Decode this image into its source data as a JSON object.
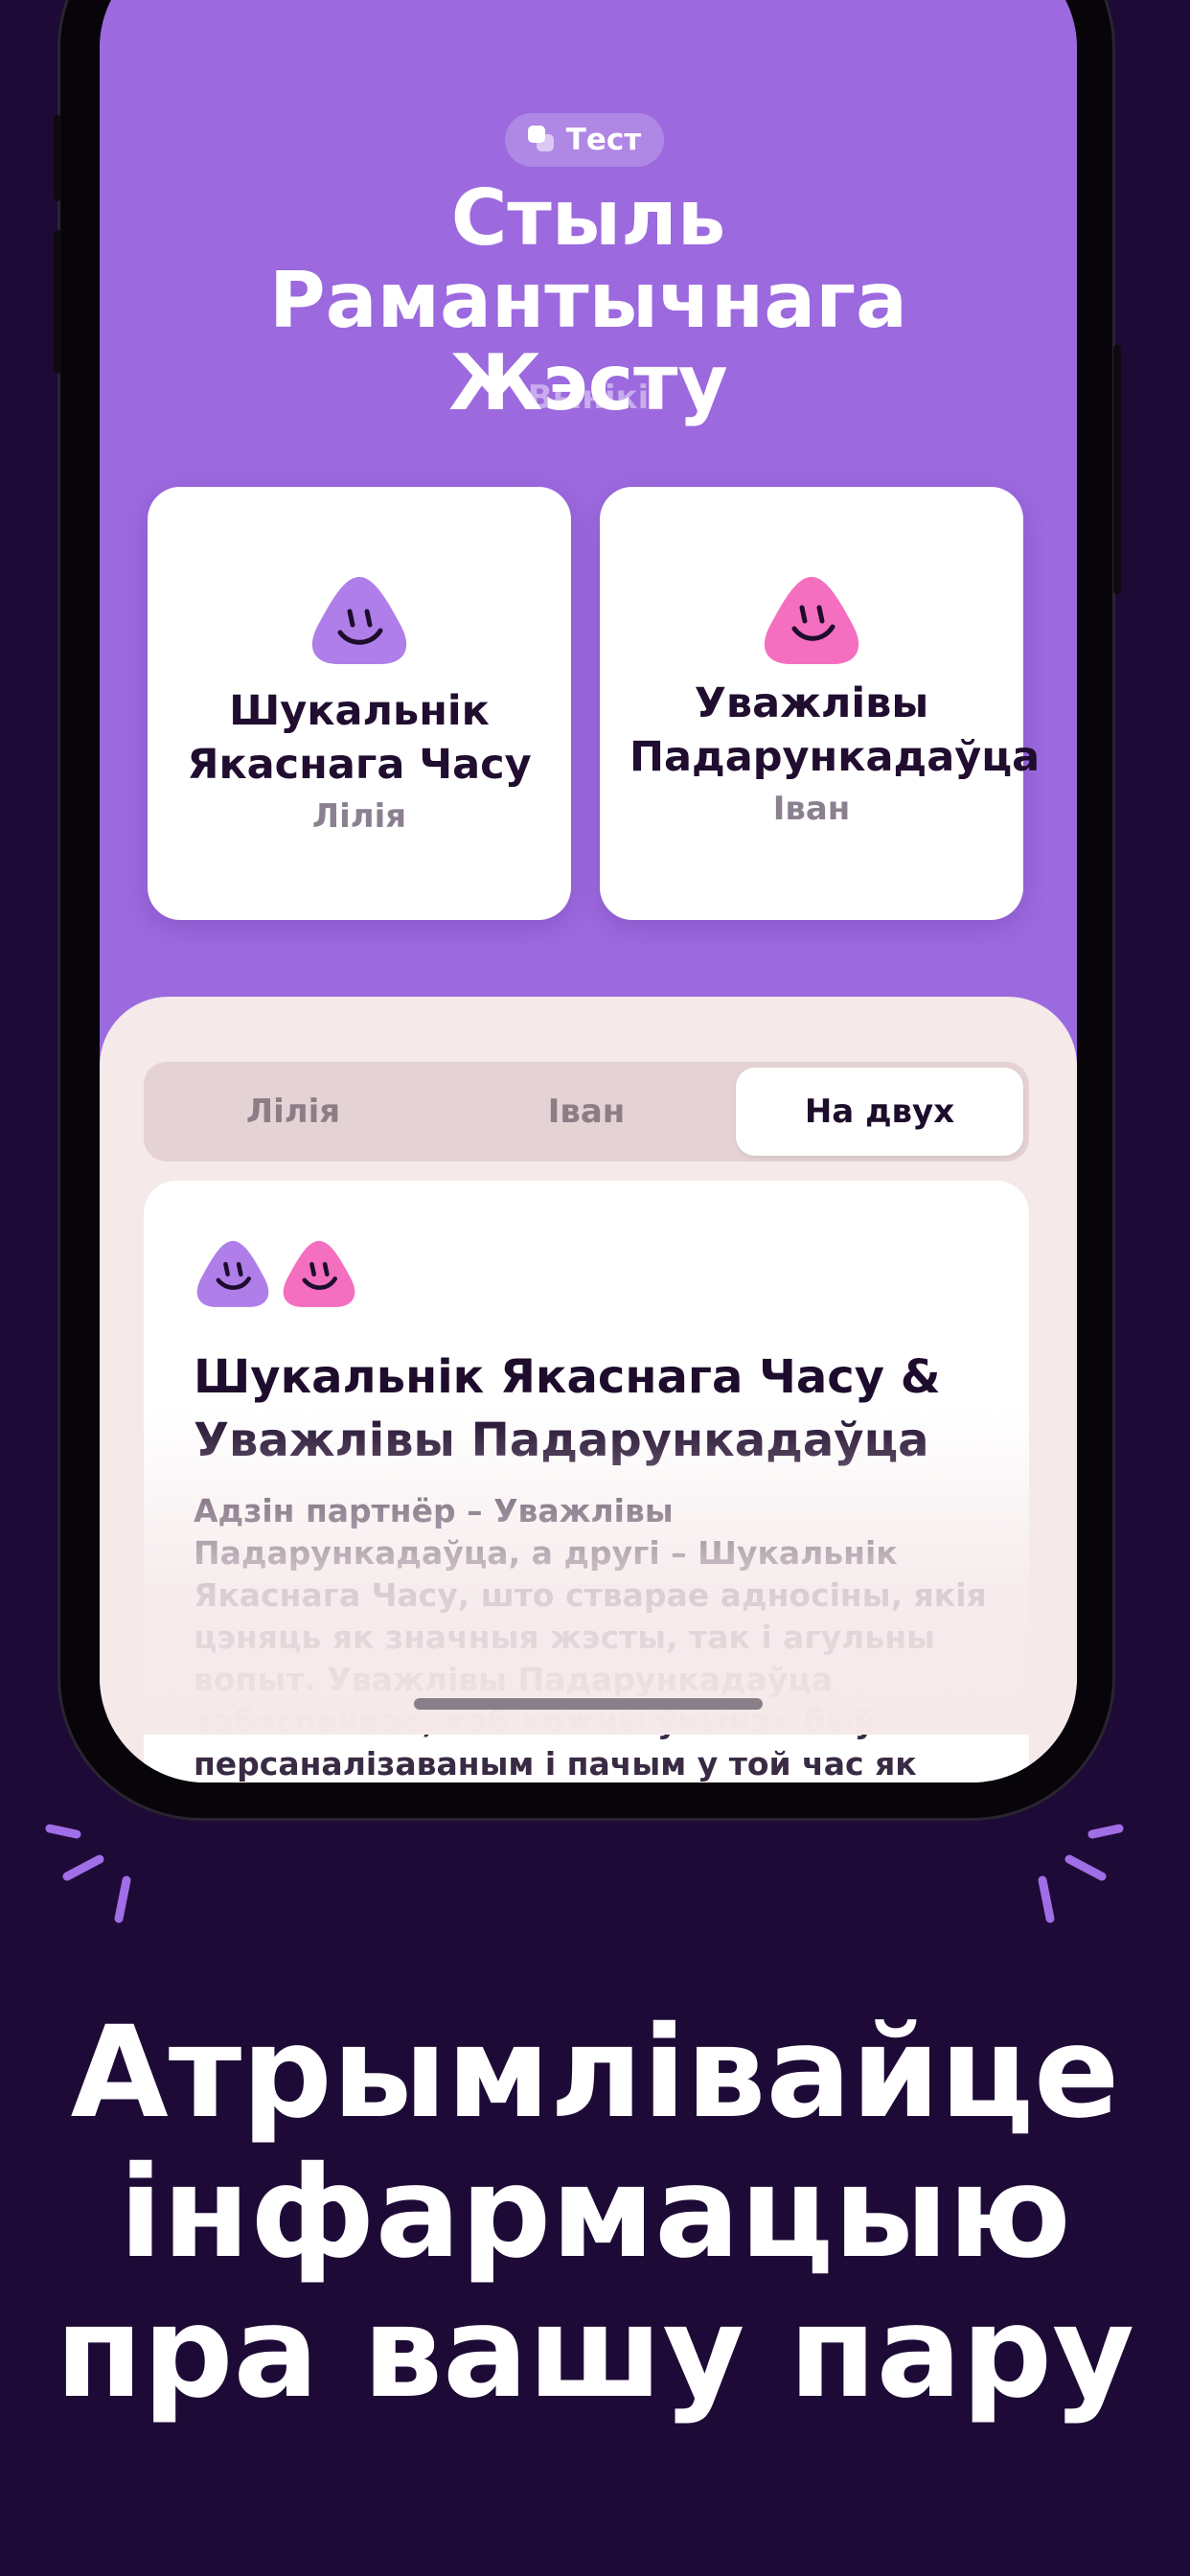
{
  "colors": {
    "background": "#1e0a36",
    "hero": "#9c69de",
    "sheet": "#f5e9ea",
    "purple_character": "#b07ee9",
    "pink_character": "#f46fc0"
  },
  "hero": {
    "badge_label": "Тест",
    "badge_icon": "layers-icon",
    "title": "Стыль Рамантычнага Жэсту",
    "subtitle": "Вынікі"
  },
  "results": [
    {
      "title": "Шукальнік Якаснага Часу",
      "name": "Лілія",
      "icon": "purple-smiley-icon"
    },
    {
      "title": "Уважлівы Падарункадаўца",
      "name": "Іван",
      "icon": "pink-smiley-icon"
    }
  ],
  "segments": [
    {
      "label": "Лілія",
      "active": false
    },
    {
      "label": "Іван",
      "active": false
    },
    {
      "label": "На двух",
      "active": true
    }
  ],
  "summary": {
    "title": "Шукальнік Якаснага Часу & Уважлівы Падарункадаўца",
    "body": "Адзін партнёр – Уважлівы Падарункадаўца, а другі – Шукальнік Якаснага Часу, што стварае адносіны, якія цэняць як значныя жэсты, так і агульны вопыт. Уважлівы Падарункадаўца забяспечвае, каб кожны ўчынак быў персаналізаваным і пачым у той час як"
  },
  "headline": "Атрымлівайце інфармацыю пра вашу пару"
}
